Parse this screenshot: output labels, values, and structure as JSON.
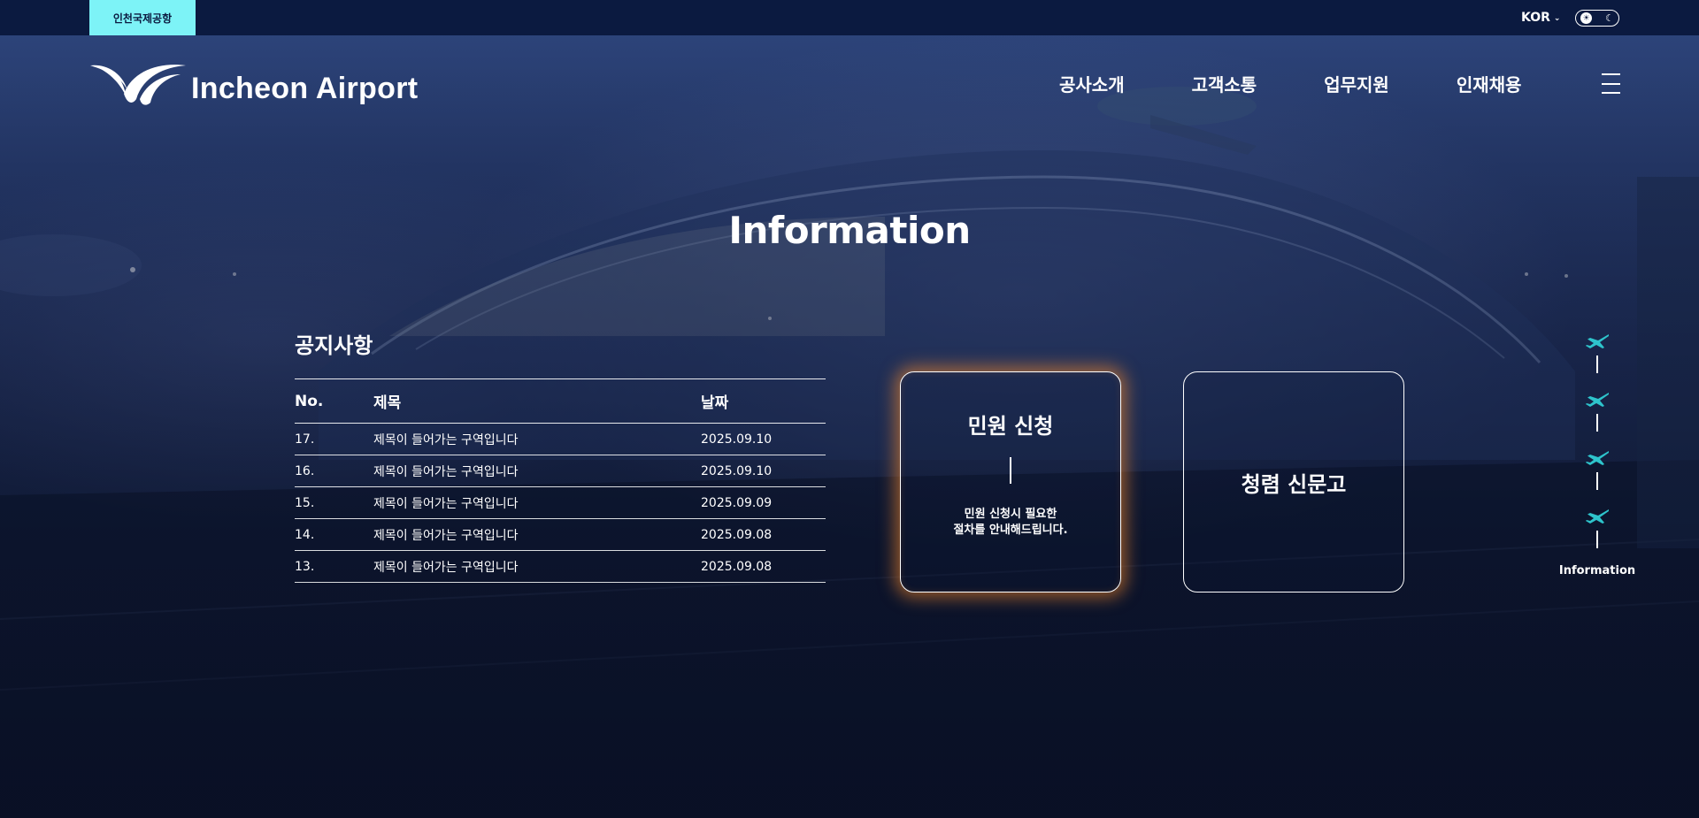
{
  "topbar": {
    "brand_tab": "인천국제공항",
    "language": "KOR",
    "theme_icons": {
      "light": "sun-icon",
      "dark": "moon-icon"
    }
  },
  "header": {
    "logo_text": "Incheon Airport",
    "nav": [
      "공사소개",
      "고객소통",
      "업무지원",
      "인재채용"
    ]
  },
  "main": {
    "title": "Information",
    "notice": {
      "title": "공지사항",
      "columns": {
        "no": "No.",
        "title": "제목",
        "date": "날짜"
      },
      "rows": [
        {
          "no": "17.",
          "title": "제목이 들어가는 구역입니다",
          "date": "2025.09.10"
        },
        {
          "no": "16.",
          "title": "제목이 들어가는 구역입니다",
          "date": "2025.09.10"
        },
        {
          "no": "15.",
          "title": "제목이 들어가는 구역입니다",
          "date": "2025.09.09"
        },
        {
          "no": "14.",
          "title": "제목이 들어가는 구역입니다",
          "date": "2025.09.08"
        },
        {
          "no": "13.",
          "title": "제목이 들어가는 구역입니다",
          "date": "2025.09.08"
        }
      ]
    },
    "cards": {
      "civil": {
        "title": "민원 신청",
        "desc_line1": "민원 신청시 필요한",
        "desc_line2": "절차를 안내해드립니다."
      },
      "report": {
        "title": "청렴 신문고"
      }
    },
    "side_nav": {
      "label": "Information",
      "items": 4,
      "icon": "airplane-icon"
    }
  },
  "colors": {
    "topbar": "#0b1a40",
    "brand_tab": "#7df3f7",
    "plane_icon": "#2ec4cc",
    "card_glow": "#ff8c28"
  }
}
